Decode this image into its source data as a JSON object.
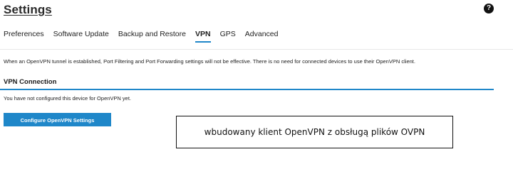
{
  "header": {
    "title": "Settings",
    "help_icon_glyph": "?",
    "help_icon": "question-mark-icon"
  },
  "tabs": [
    {
      "label": "Preferences",
      "active": false
    },
    {
      "label": "Software Update",
      "active": false
    },
    {
      "label": "Backup and Restore",
      "active": false
    },
    {
      "label": "VPN",
      "active": true
    },
    {
      "label": "GPS",
      "active": false
    },
    {
      "label": "Advanced",
      "active": false
    }
  ],
  "main": {
    "info_text": "When an OpenVPN tunnel is established, Port Filtering and Port Forwarding settings will not be effective. There is no need for connected devices to use their OpenVPN client.",
    "section_title": "VPN Connection",
    "status_text": "You have not configured this device for OpenVPN yet.",
    "configure_button_label": "Configure OpenVPN Settings"
  },
  "overlay": {
    "caption": "wbudowany klient OpenVPN z obsługą plików OVPN"
  },
  "colors": {
    "accent": "#1f87c9",
    "text": "#222222",
    "background": "#ffffff"
  }
}
